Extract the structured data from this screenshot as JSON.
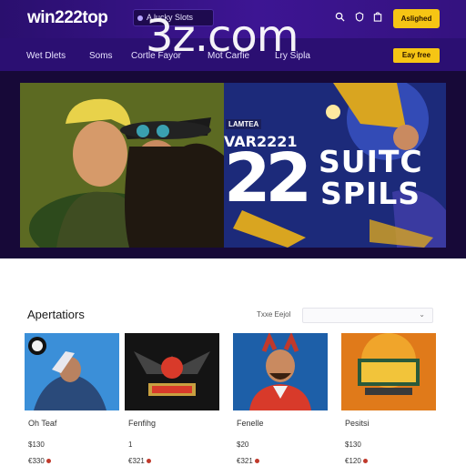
{
  "header": {
    "logo": "win222top",
    "promo": "A lucky Slots",
    "login_label": "Aslighed",
    "icons": [
      "search-icon",
      "shield-icon",
      "bag-icon"
    ]
  },
  "watermark": "3z.com",
  "nav": {
    "items": [
      "Wet Dlets",
      "Soms",
      "Cortle Fayor",
      "Mot Carfie",
      "Lry Sipla"
    ],
    "signup_label": "Eay free"
  },
  "hero": {
    "tag": "LAMTEA",
    "sub": "VAR2221",
    "big": "22",
    "word1": "SUITC",
    "word2": "SPILS"
  },
  "section": {
    "title": "Apertatiors",
    "filter_label": "Txxe Eejol",
    "filter_value": ""
  },
  "cards": [
    {
      "name": "Oh Teaf",
      "value": "$130",
      "price": "€330"
    },
    {
      "name": "Fenfihg",
      "value": "1",
      "price": "€321"
    },
    {
      "name": "Fenelle",
      "value": "$20",
      "price": "€321"
    },
    {
      "name": "Pesitsi",
      "value": "$130",
      "price": "€120"
    }
  ],
  "colors": {
    "header_bg": "#2a0f6e",
    "nav_bg": "#2b0f72",
    "accent_yellow": "#f6c514",
    "hero_bg": "#170938"
  }
}
